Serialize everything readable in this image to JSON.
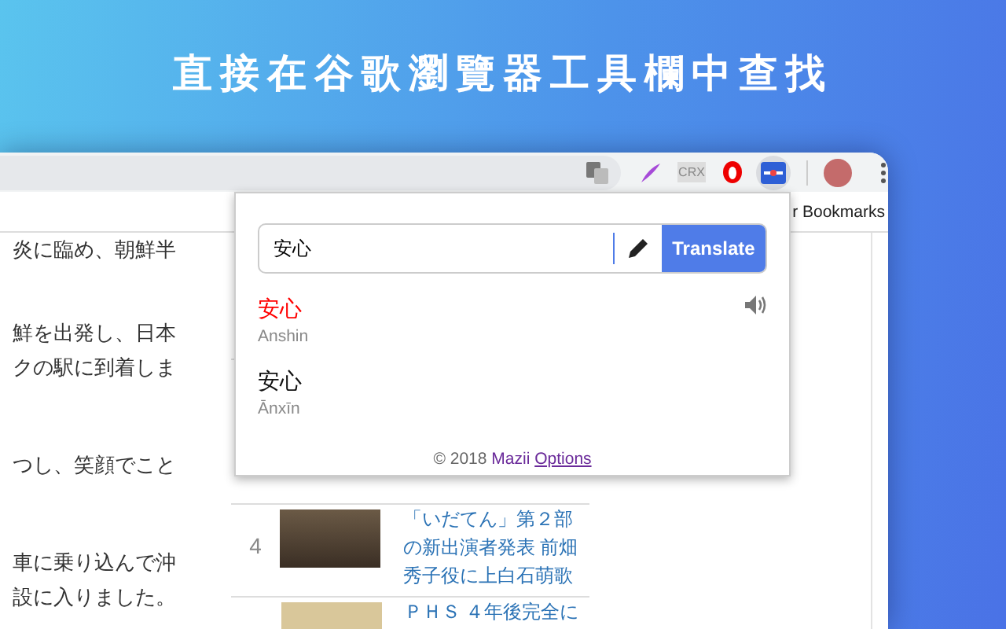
{
  "title": "直接在谷歌瀏覽器工具欄中查找",
  "toolbar": {
    "extensions": [
      {
        "kind": "pen",
        "selected": false
      },
      {
        "kind": "crx",
        "label": "CRX",
        "selected": false
      },
      {
        "kind": "shield",
        "selected": false
      },
      {
        "kind": "dictionary",
        "selected": true
      }
    ]
  },
  "bookmarks_bar": {
    "label": "r Bookmarks"
  },
  "article": [
    [
      "炎に臨め、朝鮮半"
    ],
    [
      "鮮を出発し、日本",
      "クの駅に到着しま"
    ],
    [
      "つし、笑顔でこと"
    ],
    [
      "車に乗り込んで沖",
      "設に入りました。"
    ]
  ],
  "ranking": [
    {
      "rank": "4",
      "title": "「いだてん」第２部の新出演者発表 前畑秀子役に上白石萌歌"
    },
    {
      "title": "ＰＨＳ ４年後完全に"
    }
  ],
  "popup": {
    "query": "安心",
    "button": "Translate",
    "results": [
      {
        "word": "安心",
        "reading": "Anshin",
        "highlighted": true,
        "audio": true
      },
      {
        "word": "安心",
        "reading": "Ānxīn",
        "highlighted": false,
        "audio": false
      }
    ],
    "footer": {
      "copyright": "© 2018",
      "brand": "Mazii",
      "link": "Options"
    }
  }
}
